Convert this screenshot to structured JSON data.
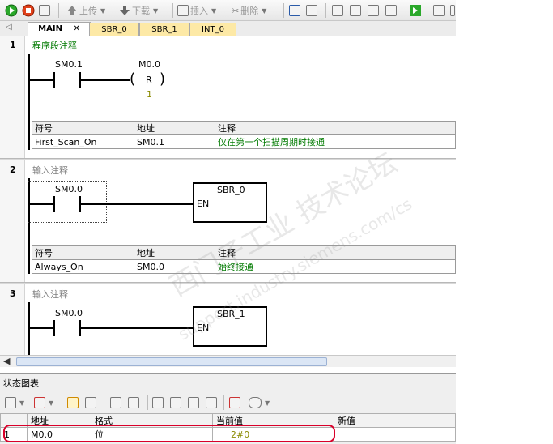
{
  "toolbar": {
    "upload_label": "上传",
    "download_label": "下载",
    "insert_label": "插入",
    "delete_label": "删除"
  },
  "tabs": [
    {
      "label": "MAIN",
      "active": true
    },
    {
      "label": "SBR_0",
      "active": false
    },
    {
      "label": "SBR_1",
      "active": false
    },
    {
      "label": "INT_0",
      "active": false
    }
  ],
  "networks": [
    {
      "number": "1",
      "comment": "程序段注释",
      "contact": "SM0.1",
      "coil_address": "M0.0",
      "coil_type": "R",
      "coil_count": "1",
      "symbol_table": {
        "headers": [
          "符号",
          "地址",
          "注释"
        ],
        "row": [
          "First_Scan_On",
          "SM0.1",
          "仅在第一个扫描周期时接通"
        ]
      }
    },
    {
      "number": "2",
      "comment": "输入注释",
      "contact": "SM0.0",
      "box_title": "SBR_0",
      "box_input": "EN",
      "symbol_table": {
        "headers": [
          "符号",
          "地址",
          "注释"
        ],
        "row": [
          "Always_On",
          "SM0.0",
          "始终接通"
        ]
      }
    },
    {
      "number": "3",
      "comment": "输入注释",
      "contact": "SM0.0",
      "box_title": "SBR_1",
      "box_input": "EN"
    }
  ],
  "status_chart": {
    "title": "状态图表",
    "headers": [
      "",
      "地址",
      "格式",
      "当前值",
      "新值"
    ],
    "rows": [
      {
        "index": "1",
        "address": "M0.0",
        "format": "位",
        "current": "2#0",
        "new": ""
      }
    ]
  },
  "watermark": {
    "line1": "西门子工业 技术论坛",
    "line2": "support.industry.siemens.com/cs"
  },
  "colors": {
    "comment_green": "#007a00",
    "tab_yellow": "#fde9a6",
    "highlight_red": "#d9002a",
    "value_olive": "#8a8a00"
  }
}
